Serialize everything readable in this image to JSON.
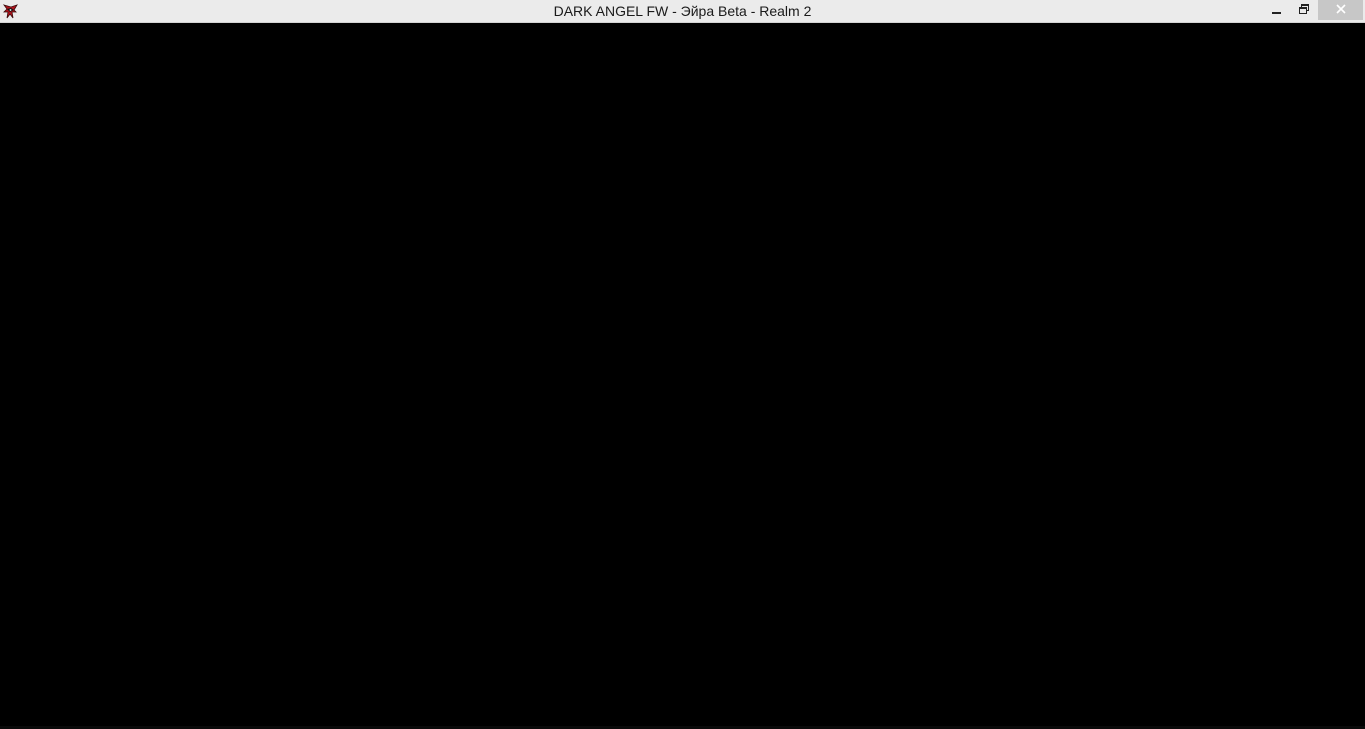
{
  "window": {
    "title": "DARK ANGEL FW - Эйра Beta - Realm 2",
    "app_icon": "dark-angel-app-icon",
    "controls": {
      "minimize_icon": "minimize-icon",
      "maximize_icon": "restore-icon",
      "close_icon": "close-icon"
    }
  },
  "colors": {
    "titlebar_bg": "#ebebeb",
    "close_bg": "#c7c7c7",
    "content_bg": "#000000",
    "icon_red": "#b0141e"
  }
}
